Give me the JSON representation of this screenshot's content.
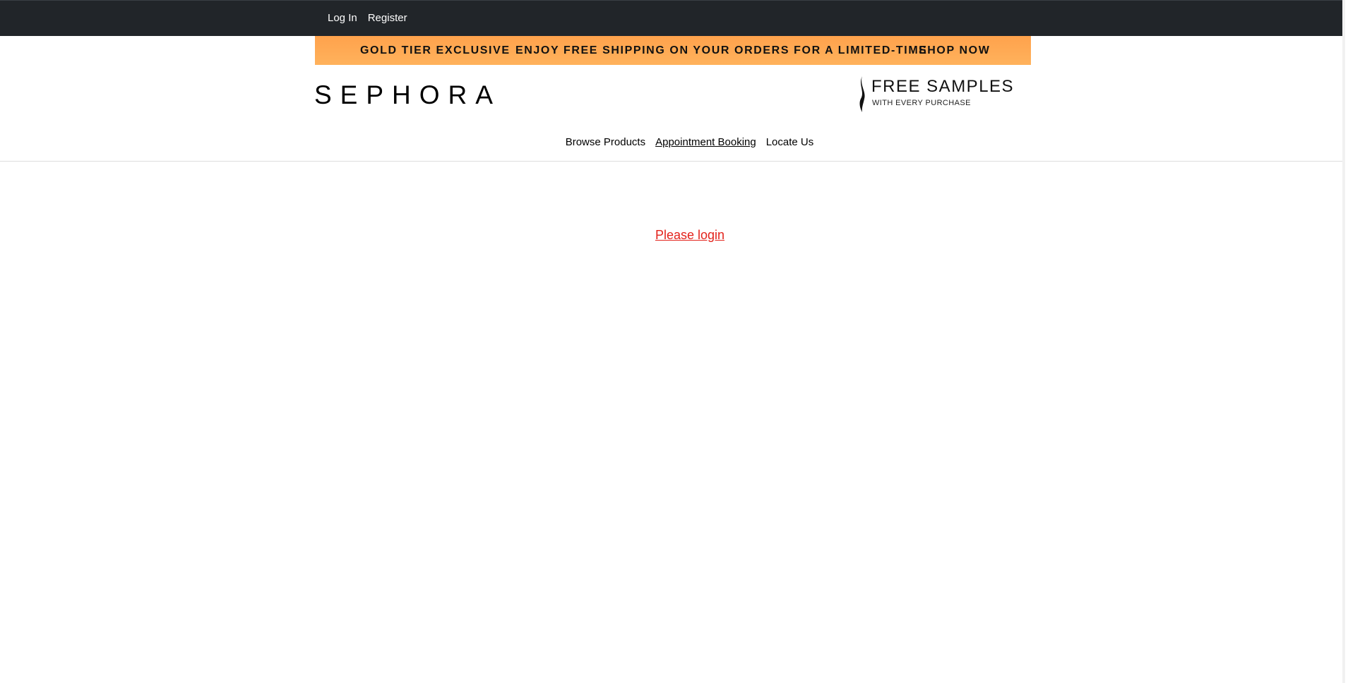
{
  "topbar": {
    "links": [
      "Log In",
      "Register"
    ],
    "background": "#212529"
  },
  "promo": {
    "left": "GOLD TIER EXCLUSIVE",
    "middle": "ENJOY FREE SHIPPING ON YOUR ORDERS FOR A LIMITED-TIME",
    "right": "SHOP NOW",
    "background": "#ffa94f"
  },
  "brand": {
    "logo": "SEPHORA"
  },
  "samples_banner": {
    "title": "FREE SAMPLES",
    "subtitle": "WITH EVERY PURCHASE",
    "icon": "sephora-flame-icon"
  },
  "nav": {
    "items": [
      "Browse Products",
      "Appointment Booking",
      "Locate Us"
    ]
  },
  "main": {
    "login_prompt": "Please login",
    "prompt_color": "#e3221b"
  }
}
